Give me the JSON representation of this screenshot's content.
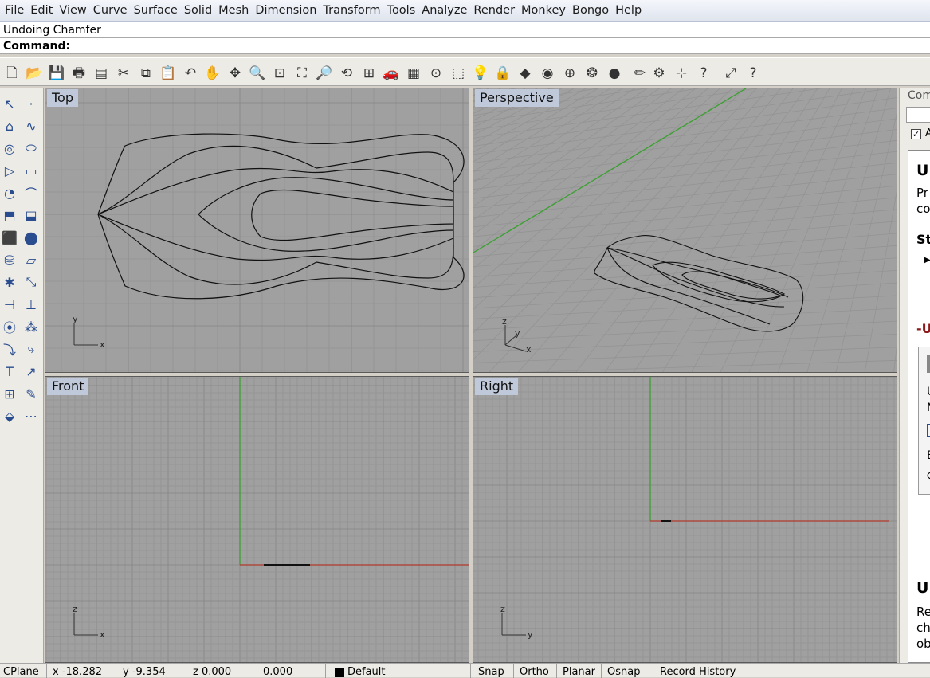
{
  "menu": [
    "File",
    "Edit",
    "View",
    "Curve",
    "Surface",
    "Solid",
    "Mesh",
    "Dimension",
    "Transform",
    "Tools",
    "Analyze",
    "Render",
    "Monkey",
    "Bongo",
    "Help"
  ],
  "history_text": "Undoing Chamfer",
  "command_label": "Command:",
  "viewports": {
    "top": "Top",
    "perspective": "Perspective",
    "front": "Front",
    "right": "Right"
  },
  "axis_labels": {
    "x": "x",
    "y": "y",
    "z": "z"
  },
  "right_panel": {
    "tab_label": "Com",
    "checkbox_label": "A",
    "heading1": "U",
    "line1": "Pr",
    "line2": "co",
    "heading2": "St",
    "heading3": "-U",
    "item1": "U",
    "item2": "N",
    "item3": "E",
    "heading4": "U",
    "line3": "Re",
    "line4": "ch",
    "line5": "ob"
  },
  "status": {
    "cplane": "CPlane",
    "x": "x -18.282",
    "y": "y -9.354",
    "z": "z 0.000",
    "dist": "0.000",
    "layer": "Default",
    "snap": "Snap",
    "ortho": "Ortho",
    "planar": "Planar",
    "osnap": "Osnap",
    "record_history": "Record History"
  },
  "colors": {
    "viewport_bg": "#a0a0a0",
    "grid_minor": "#939393",
    "grid_major": "#858585",
    "x_axis": "#b13a2a",
    "y_axis": "#3aa030",
    "title_bg": "#bfc9d9"
  }
}
